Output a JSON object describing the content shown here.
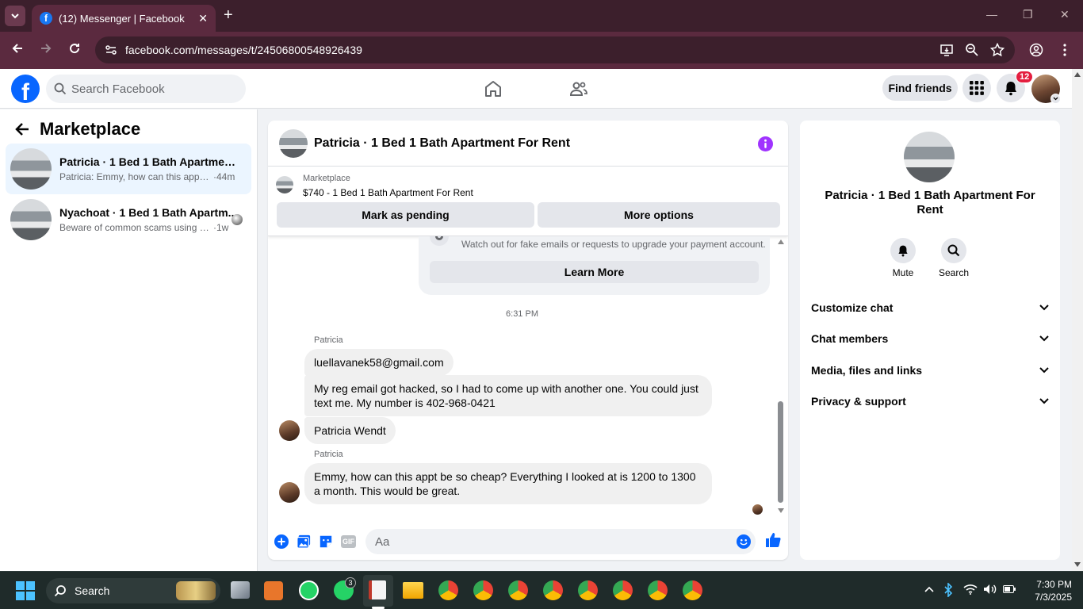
{
  "browser": {
    "tab_title": "(12) Messenger | Facebook",
    "url": "facebook.com/messages/t/24506800548926439"
  },
  "fb_header": {
    "search_placeholder": "Search Facebook",
    "find_friends": "Find friends",
    "notification_count": "12"
  },
  "left_panel": {
    "title": "Marketplace",
    "conversations": [
      {
        "name": "Patricia · 1 Bed 1 Bath Apartment F...",
        "preview": "Patricia: Emmy, how can this appt b...",
        "time": "·44m"
      },
      {
        "name": "Nyachoat · 1 Bed 1 Bath Apartm...",
        "preview": "Beware of common scams using p...",
        "time": "·1w"
      }
    ]
  },
  "chat": {
    "title": "Patricia · 1 Bed 1 Bath Apartment For Rent",
    "marketplace_label": "Marketplace",
    "listing": "$740 - 1 Bed 1 Bath Apartment For Rent",
    "mark_pending": "Mark as pending",
    "more_options": "More options",
    "warning_text": "Watch out for fake emails or requests to upgrade your payment account.",
    "learn_more": "Learn More",
    "timestamp": "6:31 PM",
    "messages": [
      {
        "sender": "Patricia",
        "text": "luellavanek58@gmail.com"
      },
      {
        "text": "My reg email got hacked, so I had to come up with another one. You could just text me. My number is   402-968-0421"
      },
      {
        "text": "Patricia Wendt"
      },
      {
        "sender": "Patricia",
        "text": "Emmy, how can this appt be so cheap? Everything I looked at is 1200 to 1300 a month. This would be great."
      }
    ],
    "input_placeholder": "Aa"
  },
  "right_panel": {
    "title": "Patricia · 1 Bed 1 Bath Apartment For Rent",
    "mute": "Mute",
    "search": "Search",
    "sections": [
      "Customize chat",
      "Chat members",
      "Media, files and links",
      "Privacy & support"
    ]
  },
  "taskbar": {
    "search": "Search",
    "time": "7:30 PM",
    "date": "7/3/2025",
    "whatsapp_badge": "3"
  },
  "colors": {
    "accent": "#0866ff",
    "info_purple": "#a033ff",
    "browser_frame": "#3c1f2c"
  }
}
